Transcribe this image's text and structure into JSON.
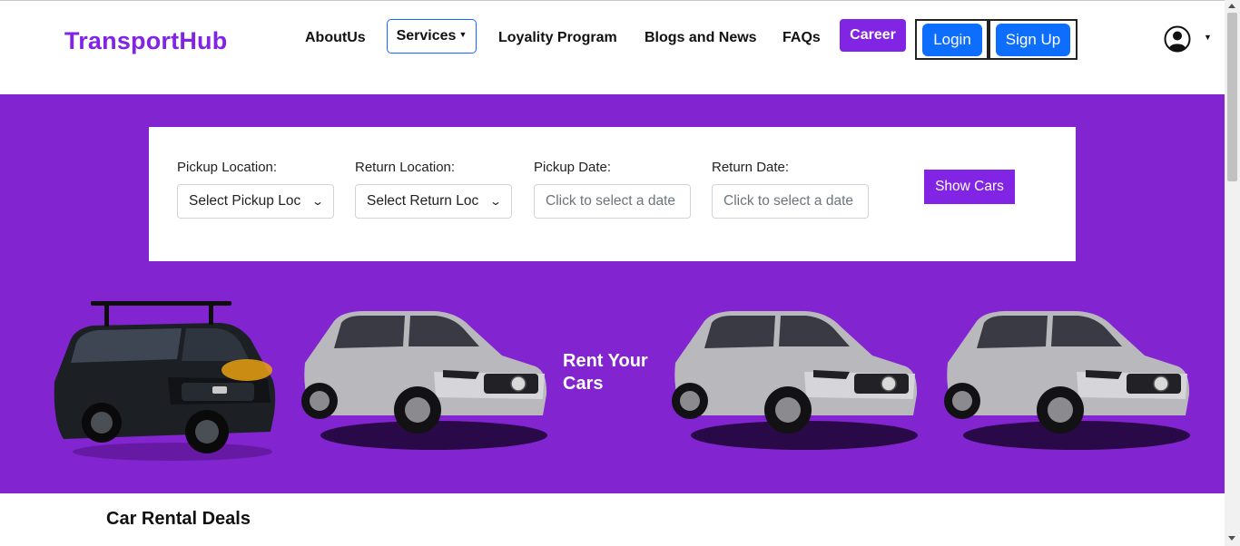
{
  "brand": "TransportHub",
  "nav": {
    "about": "AboutUs",
    "services": "Services",
    "loyalty": "Loyality Program",
    "blogs": "Blogs and News",
    "faqs": "FAQs",
    "career": "Career",
    "login": "Login",
    "signup": "Sign Up"
  },
  "search": {
    "pickup_location": {
      "label": "Pickup Location:",
      "value": "Select Pickup Loc"
    },
    "return_location": {
      "label": "Return Location:",
      "value": "Select Return Loc"
    },
    "pickup_date": {
      "label": "Pickup Date:",
      "placeholder": "Click to select a date"
    },
    "return_date": {
      "label": "Return Date:",
      "placeholder": "Click to select a date"
    },
    "submit": "Show Cars"
  },
  "hero": {
    "tagline": "Rent Your Cars",
    "cars": [
      "dark-suv-image",
      "silver-suv-image",
      "silver-suv-image",
      "silver-suv-image"
    ]
  },
  "deals": {
    "title": "Car Rental Deals"
  },
  "colors": {
    "brand": "#8224e3",
    "hero_bg": "#8224cf",
    "primary": "#0d6efd"
  },
  "icons": {
    "user": "user-circle-icon",
    "dropdown": "caret-down-icon",
    "select": "chevron-down-icon"
  }
}
